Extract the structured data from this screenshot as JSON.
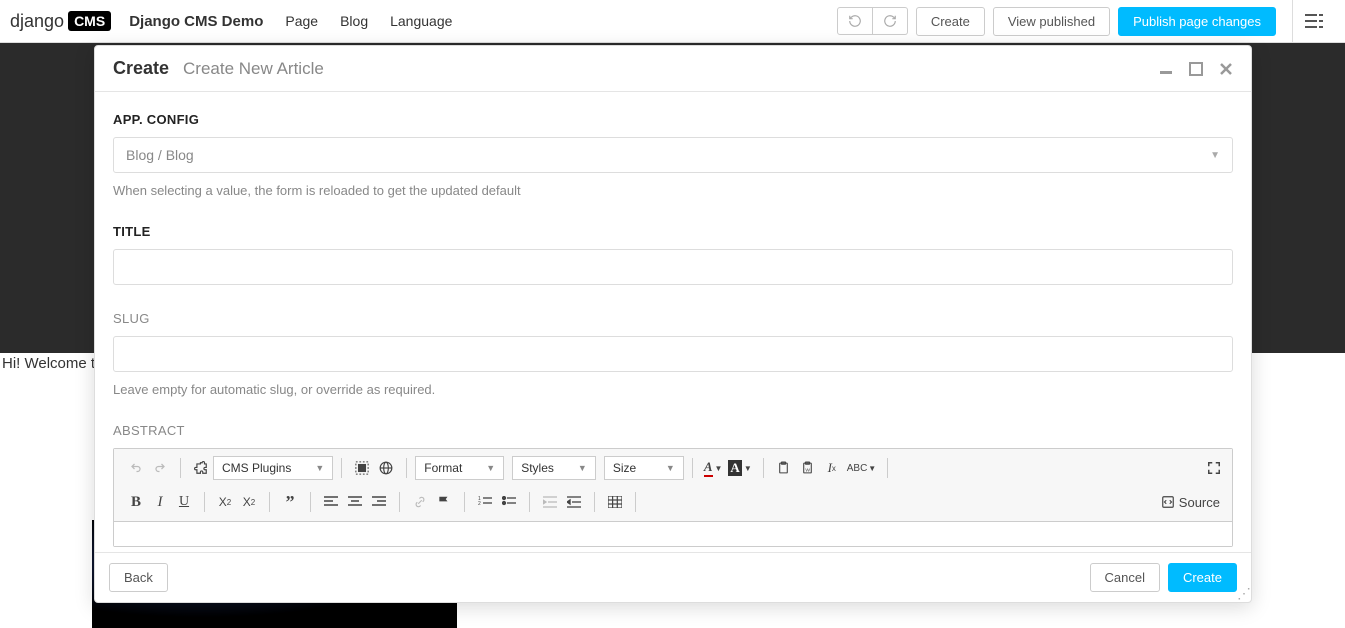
{
  "topbar": {
    "logo_text": "django",
    "logo_badge": "CMS",
    "site_title": "Django CMS Demo",
    "menu": [
      "Page",
      "Blog",
      "Language"
    ],
    "create_label": "Create",
    "view_published_label": "View published",
    "publish_label": "Publish page changes"
  },
  "background": {
    "welcome_text": "Hi! Welcome to"
  },
  "modal": {
    "title": "Create",
    "subtitle": "Create New Article",
    "fields": {
      "app_config": {
        "label": "App. Config",
        "value": "Blog / Blog",
        "help": "When selecting a value, the form is reloaded to get the updated default"
      },
      "title": {
        "label": "Title",
        "value": ""
      },
      "slug": {
        "label": "Slug",
        "value": "",
        "help": "Leave empty for automatic slug, or override as required."
      },
      "abstract": {
        "label": "Abstract"
      }
    },
    "editor": {
      "cms_plugins_label": "CMS Plugins",
      "format_label": "Format",
      "styles_label": "Styles",
      "size_label": "Size",
      "source_label": "Source"
    },
    "footer": {
      "back_label": "Back",
      "cancel_label": "Cancel",
      "create_label": "Create"
    }
  }
}
